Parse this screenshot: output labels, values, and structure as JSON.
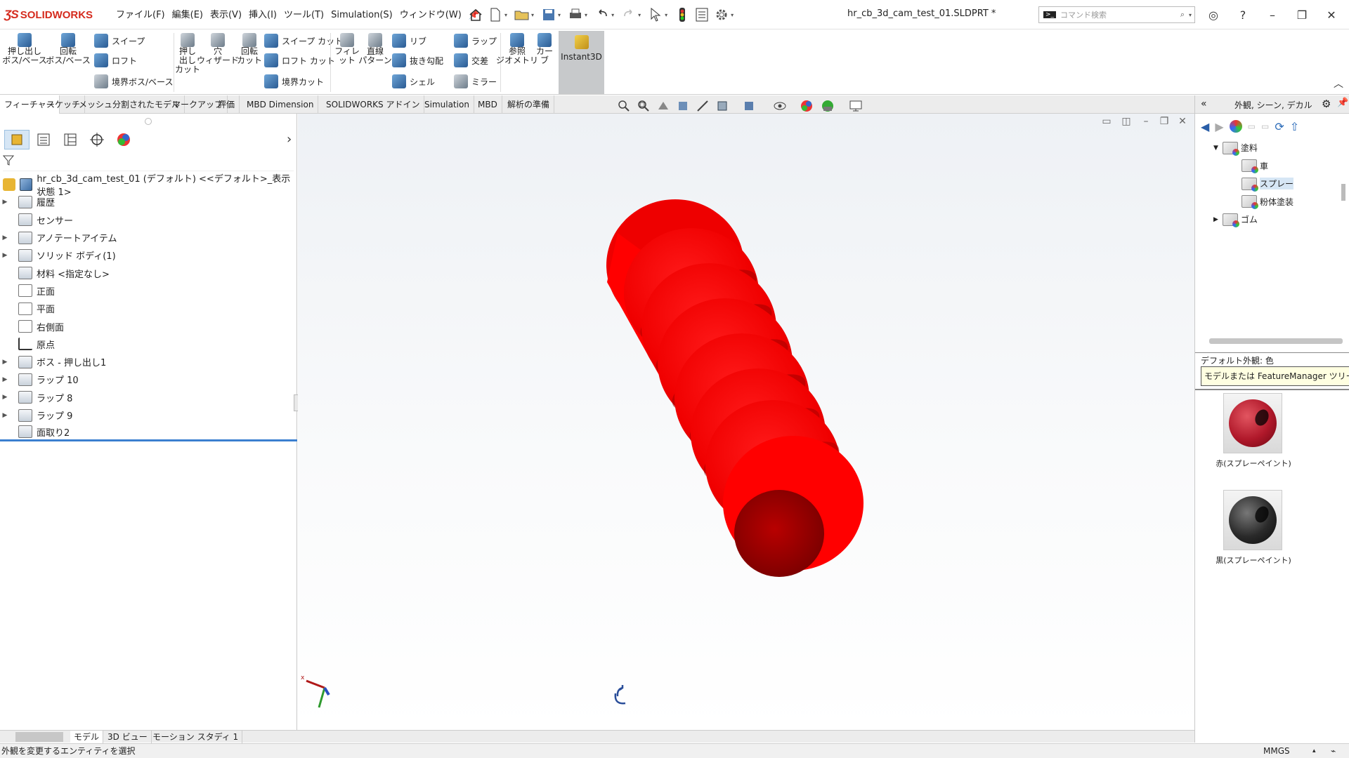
{
  "app": {
    "name": "SOLIDWORKS",
    "document_title": "hr_cb_3d_cam_test_01.SLDPRT *"
  },
  "menu": [
    "ファイル(F)",
    "編集(E)",
    "表示(V)",
    "挿入(I)",
    "ツール(T)",
    "Simulation(S)",
    "ウィンドウ(W)"
  ],
  "search": {
    "placeholder": "コマンド検索"
  },
  "ribbon": {
    "extrude_boss": "押し出し\nボス/ベース",
    "revolve_boss": "回転\nボス/ベース",
    "sweep": "スイープ",
    "loft": "ロフト",
    "boundary_boss": "境界ボス/ベース",
    "extrude_cut": "押し\n出し\nカット",
    "hole_wizard": "穴\nウィザード",
    "revolve_cut": "回転\nカット",
    "sweep_cut": "スイープ カット",
    "loft_cut": "ロフト カット",
    "boundary_cut": "境界カット",
    "fillet": "フィレット",
    "linear_pattern": "直線\nパターン",
    "rib": "リブ",
    "draft": "抜き勾配",
    "shell": "シェル",
    "wrap": "ラップ",
    "intersect": "交差",
    "mirror": "ミラー",
    "ref_geometry": "参照\nジオメトリ",
    "curves": "カーブ",
    "instant3d": "Instant3D"
  },
  "tabs": [
    "フィーチャー",
    "スケッチ",
    "メッシュ分割されたモデル",
    "マークアップ",
    "評価",
    "MBD Dimension",
    "SOLIDWORKS アドイン",
    "Simulation",
    "MBD",
    "解析の準備"
  ],
  "feature_tree": {
    "root": "hr_cb_3d_cam_test_01 (デフォルト) <<デフォルト>_表示状態 1>",
    "items": [
      {
        "label": "履歴",
        "expandable": true
      },
      {
        "label": "センサー",
        "expandable": false
      },
      {
        "label": "アノテートアイテム",
        "expandable": true
      },
      {
        "label": "ソリッド ボディ(1)",
        "expandable": true
      },
      {
        "label": "材料 <指定なし>",
        "expandable": false
      },
      {
        "label": "正面",
        "expandable": false
      },
      {
        "label": "平面",
        "expandable": false
      },
      {
        "label": "右側面",
        "expandable": false
      },
      {
        "label": "原点",
        "expandable": false
      },
      {
        "label": "ボス - 押し出し1",
        "expandable": true
      },
      {
        "label": "ラップ 10",
        "expandable": true
      },
      {
        "label": "ラップ 8",
        "expandable": true
      },
      {
        "label": "ラップ 9",
        "expandable": true
      },
      {
        "label": "面取り2",
        "expandable": false
      }
    ]
  },
  "bottom_tabs": [
    "モデル",
    "3D ビュー",
    "モーション スタディ 1"
  ],
  "task_pane": {
    "title": "外観, シーン, デカル",
    "tree": [
      {
        "label": "塗料",
        "level": 1,
        "expanded": true
      },
      {
        "label": "車",
        "level": 2
      },
      {
        "label": "スプレー",
        "level": 2,
        "selected": true
      },
      {
        "label": "粉体塗装",
        "level": 2
      },
      {
        "label": "ゴム",
        "level": 1,
        "expanded": false
      }
    ],
    "default_label": "デフォルト外観: 色",
    "tooltip": "モデルまたは FeatureManager ツリーに...",
    "swatches": [
      {
        "label": "赤(スプレーペイント)",
        "color": "#c0202a"
      },
      {
        "label": "黒(スプレーペイント)",
        "color": "#1e1e1e"
      }
    ]
  },
  "status": {
    "message": "外観を変更するエンティティを選択",
    "units": "MMGS"
  },
  "colors": {
    "model": "#ff0000",
    "accent": "#3b7fd0",
    "brand": "#d52b1e"
  }
}
